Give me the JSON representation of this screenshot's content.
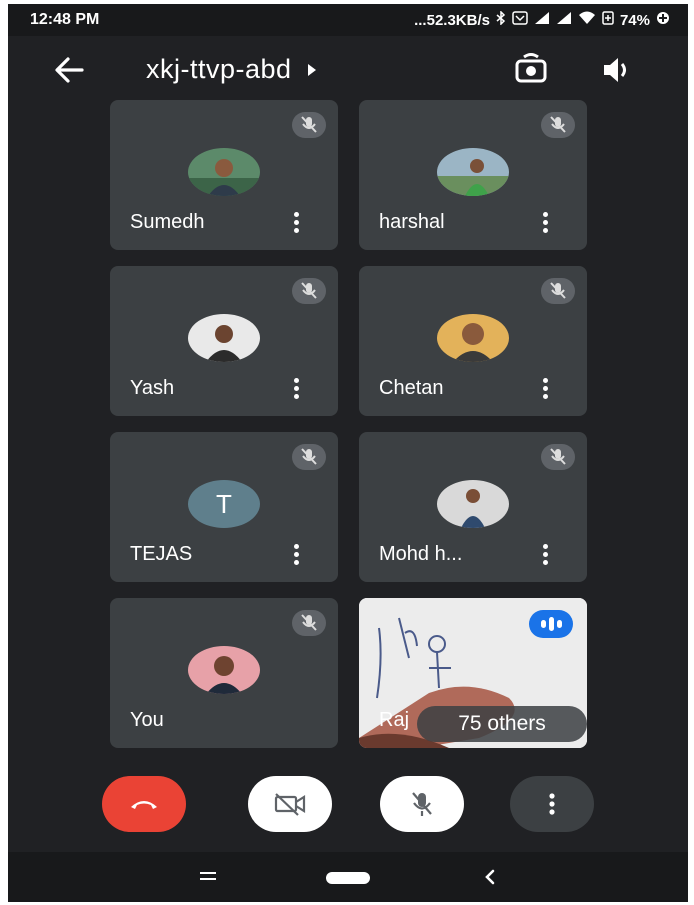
{
  "status_bar": {
    "time": "12:48 PM",
    "speed": "...52.3KB/s",
    "battery": "74%"
  },
  "header": {
    "meeting_code": "xkj-ttvp-abd",
    "icons": [
      "back-arrow-icon",
      "flip-camera-icon",
      "speaker-icon"
    ]
  },
  "participants": [
    {
      "name": "Sumedh",
      "muted": true,
      "avatar": "photo"
    },
    {
      "name": "harshal",
      "muted": true,
      "avatar": "photo"
    },
    {
      "name": "Yash",
      "muted": true,
      "avatar": "photo"
    },
    {
      "name": "Chetan",
      "muted": true,
      "avatar": "photo"
    },
    {
      "name": "TEJAS",
      "muted": true,
      "avatar": "letter",
      "initial": "T"
    },
    {
      "name": "Mohd h...",
      "muted": true,
      "avatar": "photo"
    },
    {
      "name": "You",
      "muted": true,
      "avatar": "photo"
    }
  ],
  "video_tile": {
    "name_partial": "Raj",
    "others_label": "75 others",
    "speaking": true
  },
  "controls": {
    "icons": [
      "hang-up-icon",
      "camera-off-icon",
      "mic-off-icon",
      "more-options-icon"
    ]
  },
  "colors": {
    "background": "#202124",
    "tile": "#3c4043",
    "hangup": "#ea4335",
    "speaking": "#1a73e8"
  }
}
